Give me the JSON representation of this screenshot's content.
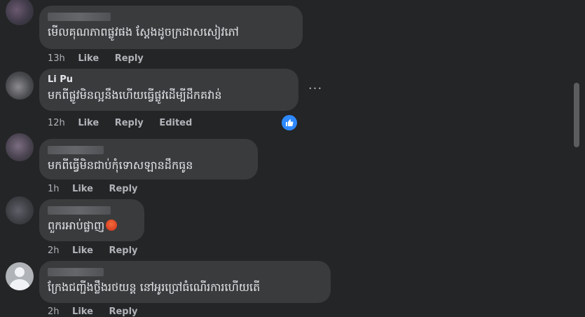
{
  "comments": [
    {
      "author": "",
      "text": "មើលគុណភាពផ្លូវផង ស្តែងដូចក្រដាសសៀវភៅ",
      "time": "13h",
      "like": "Like",
      "reply": "Reply"
    },
    {
      "author": "Li Pu",
      "text": "មកពីផ្លូវមិនល្អនឹងហើយធ្វើផ្លូវដើម្បីដឹកគវាន់",
      "time": "12h",
      "like": "Like",
      "reply": "Reply",
      "edited": "Edited"
    },
    {
      "author": "",
      "text": "មកពីធ្វើមិនជាប់កុំទោសឡានដឹកធូន",
      "time": "1h",
      "like": "Like",
      "reply": "Reply"
    },
    {
      "author": "",
      "text": "ពួករអាប់ផ្លាញ",
      "time": "2h",
      "like": "Like",
      "reply": "Reply"
    },
    {
      "author": "",
      "text": "ក្រែងជញ្ជីងថ្លឹងរថយន្ត នៅអូរប្រៅធំណើរការហើយតើ",
      "time": "2h",
      "like": "Like",
      "reply": "Reply"
    }
  ],
  "icons": {
    "more": "more-options-icon",
    "like_reaction": "thumbs-up-icon",
    "emoji": "angry-face-emoji",
    "avatar_default": "default-avatar-icon"
  },
  "colors": {
    "background": "#242526",
    "bubble": "#3a3b3c",
    "text": "#e4e6eb",
    "secondary": "#b0b3b8",
    "like_blue": "#2e89ff"
  }
}
